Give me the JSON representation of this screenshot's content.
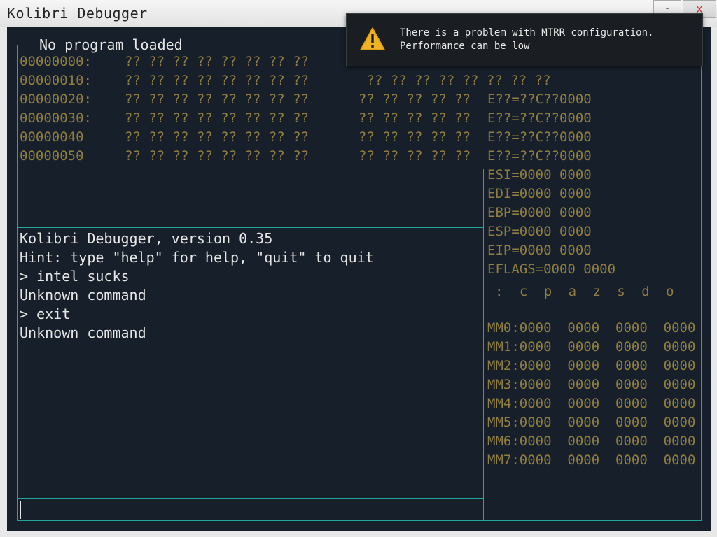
{
  "window": {
    "title": "Kolibri Debugger",
    "minimize_label": "-",
    "close_label": "x"
  },
  "frame": {
    "title": "No program loaded"
  },
  "dump": {
    "rows": [
      {
        "addr": "00000000:",
        "hexa": "?? ?? ?? ?? ?? ?? ?? ??",
        "hexb": ""
      },
      {
        "addr": "00000010:",
        "hexa": "?? ?? ?? ?? ?? ?? ?? ??",
        "hexb": " ?? ?? ?? ?? ?? ?? ?? ??"
      },
      {
        "addr": "00000020:",
        "hexa": "?? ?? ?? ?? ?? ?? ?? ??",
        "hexb": "?? ?? ?? ?? ??"
      },
      {
        "addr": "00000030:",
        "hexa": "?? ?? ?? ?? ?? ?? ?? ??",
        "hexb": "?? ?? ?? ?? ??"
      },
      {
        "addr": "00000040",
        "hexa": "?? ?? ?? ?? ?? ?? ?? ??",
        "hexb": "?? ?? ?? ?? ??"
      },
      {
        "addr": "00000050",
        "hexa": "?? ?? ?? ?? ?? ?? ?? ??",
        "hexb": "?? ?? ?? ?? ??"
      }
    ]
  },
  "registers": [
    "E??=??C??0000",
    "E??=??C??0000",
    "E??=??C??0000",
    "E??=??C??0000",
    "ESI=0000 0000",
    "EDI=0000 0000",
    "EBP=0000 0000",
    "ESP=0000 0000",
    "EIP=0000 0000",
    "EFLAGS=0000 0000"
  ],
  "flags_line": ": c p a z s d o",
  "mmx": [
    "MM0:0000  0000  0000  0000",
    "MM1:0000  0000  0000  0000",
    "MM2:0000  0000  0000  0000",
    "MM3:0000  0000  0000  0000",
    "MM4:0000  0000  0000  0000",
    "MM5:0000  0000  0000  0000",
    "MM6:0000  0000  0000  0000",
    "MM7:0000  0000  0000  0000"
  ],
  "console": {
    "lines": [
      "Kolibri Debugger, version 0.35",
      "Hint: type \"help\" for help, \"quit\" to quit",
      "> intel sucks",
      "Unknown command",
      "> exit",
      "Unknown command"
    ],
    "input_value": ""
  },
  "notification": {
    "icon": "warning-icon",
    "line1": "There is a problem with MTRR configuration.",
    "line2": "Performance can be low"
  },
  "colors": {
    "background": "#17202a",
    "border": "#1fa79b",
    "text": "#e6e6e6",
    "data_text": "#8f7d42",
    "warning": "#f0b323"
  }
}
